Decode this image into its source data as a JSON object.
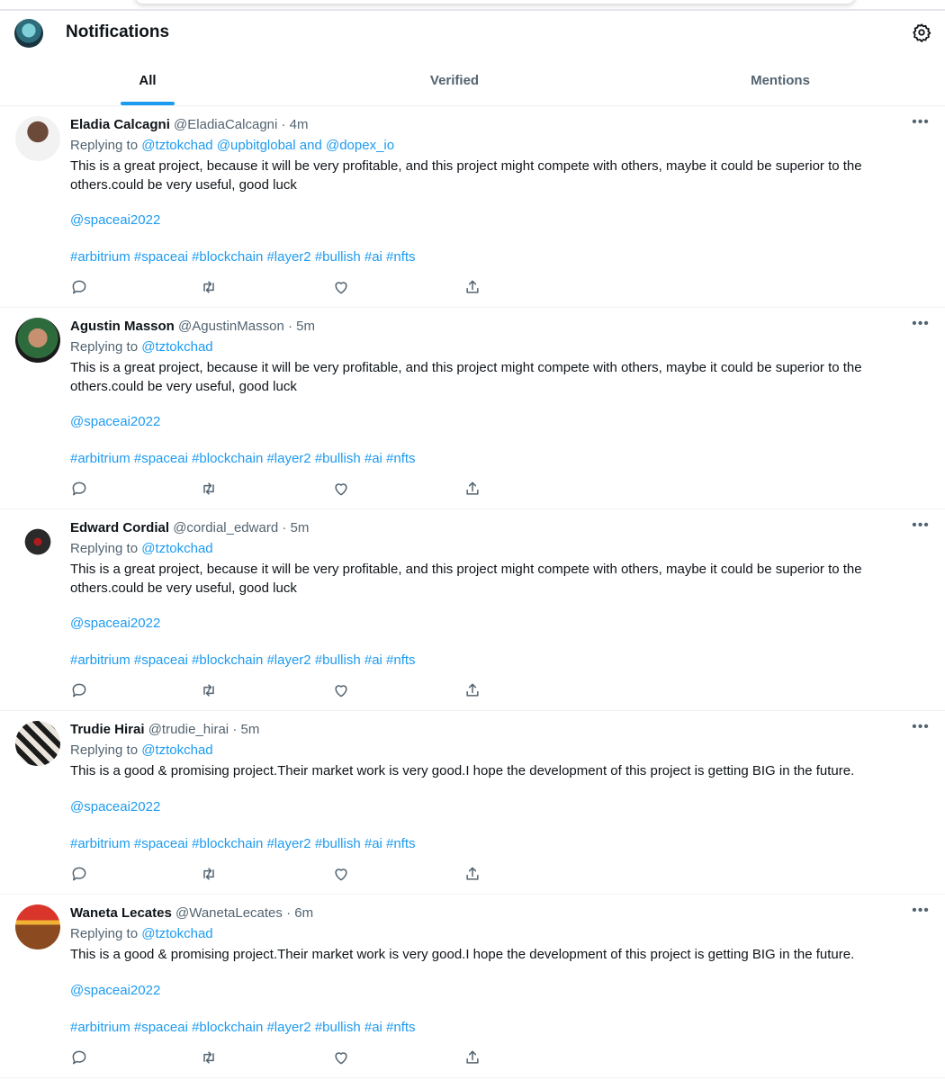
{
  "header": {
    "title": "Notifications"
  },
  "tabs": [
    {
      "label": "All",
      "active": true
    },
    {
      "label": "Verified",
      "active": false
    },
    {
      "label": "Mentions",
      "active": false
    }
  ],
  "reply_prefix": "Replying to",
  "tweets": [
    {
      "name": "Eladia Calcagni",
      "handle": "@EladiaCalcagni",
      "time": "· 4m",
      "replying_to": "@tztokchad @upbitglobal and @dopex_io",
      "body": "This is a great project, because it will be very profitable, and this project might compete with others, maybe it could be superior to the others.could be very useful, good luck",
      "mention": "@spaceai2022",
      "hashtags": "#arbitrium #spaceai #blockchain #layer2 #bullish #ai #nfts"
    },
    {
      "name": "Agustin Masson",
      "handle": "@AgustinMasson",
      "time": "· 5m",
      "replying_to": "@tztokchad",
      "body": "This is a great project, because it will be very profitable, and this project might compete with others, maybe it could be superior to the others.could be very useful, good luck",
      "mention": "@spaceai2022",
      "hashtags": "#arbitrium #spaceai #blockchain #layer2 #bullish #ai #nfts"
    },
    {
      "name": "Edward Cordial",
      "handle": "@cordial_edward",
      "time": "· 5m",
      "replying_to": "@tztokchad",
      "body": "This is a great project, because it will be very profitable, and this project might compete with others, maybe it could be superior to the others.could be very useful, good luck",
      "mention": "@spaceai2022",
      "hashtags": "#arbitrium #spaceai #blockchain #layer2 #bullish #ai #nfts"
    },
    {
      "name": "Trudie Hirai",
      "handle": "@trudie_hirai",
      "time": "· 5m",
      "replying_to": "@tztokchad",
      "body": "This is a good & promising project.Their market work is very good.I hope the development of this project is getting BIG in the future.",
      "mention": "@spaceai2022",
      "hashtags": "#arbitrium #spaceai #blockchain #layer2 #bullish #ai #nfts"
    },
    {
      "name": "Waneta Lecates",
      "handle": "@WanetaLecates",
      "time": "· 6m",
      "replying_to": "@tztokchad",
      "body": "This is a good & promising project.Their market work is very good.I hope the development of this project is getting BIG in the future.",
      "mention": "@spaceai2022",
      "hashtags": "#arbitrium #spaceai #blockchain #layer2 #bullish #ai #nfts"
    }
  ],
  "colors": {
    "accent": "#1d9bf0",
    "text": "#0f1419",
    "muted": "#536471",
    "divider": "#eff3f4"
  },
  "icons": {
    "header": [
      "profile-avatar",
      "gear-icon"
    ],
    "more": "more-dots-icon",
    "actions": [
      "reply-icon",
      "retweet-icon",
      "like-icon",
      "share-icon"
    ]
  }
}
